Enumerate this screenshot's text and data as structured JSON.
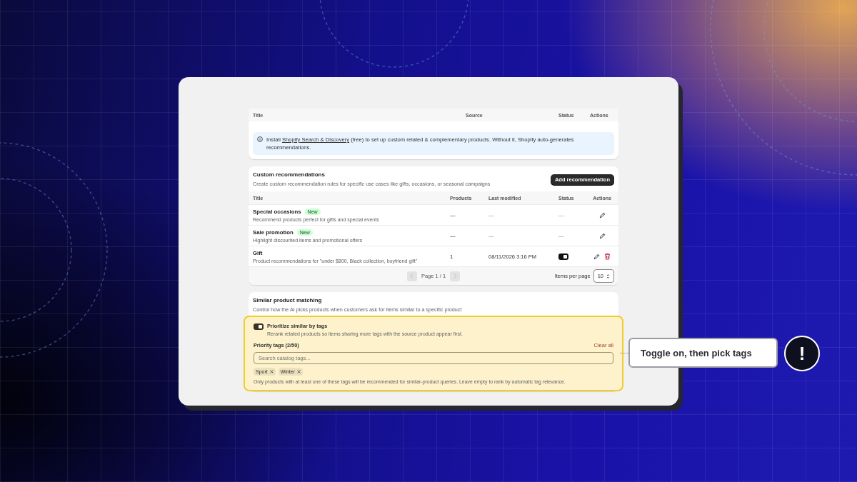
{
  "source_table": {
    "columns": [
      "Title",
      "Source",
      "Status",
      "Actions"
    ]
  },
  "info_banner": {
    "text_before": "Install ",
    "link": "Shopify Search & Discovery",
    "text_after": " (free) to set up custom related & complementary products. Without it, Shopify auto-generates recommendations."
  },
  "custom_recommendations": {
    "title": "Custom recommendations",
    "description": "Create custom recommendation rules for specific use cases like gifts, occasions, or seasonal campaigns",
    "add_button": "Add recommendation",
    "columns": [
      "Title",
      "Products",
      "Last modified",
      "Status",
      "Actions"
    ],
    "rows": [
      {
        "title": "Special occasions",
        "badge": "New",
        "description": "Recommend products perfect for gifts and special events",
        "products": "—",
        "last_modified": "—",
        "kind": "text",
        "status": "—",
        "deletable": false
      },
      {
        "title": "Sale promotion",
        "badge": "New",
        "description": "Highlight discounted items and promotional offers",
        "products": "—",
        "last_modified": "—",
        "kind": "text",
        "status": "—",
        "deletable": false
      },
      {
        "title": "Gift",
        "description": "Product recommendations for \"under $800, Black collection, boyfriend gift\"",
        "products": "1",
        "last_modified": "08/11/2026 3:16 PM",
        "kind": "toggle",
        "on": true,
        "deletable": true
      }
    ],
    "pagination": {
      "page": "Page 1 / 1",
      "prev_disabled": true,
      "next_disabled": true,
      "items_per_page_label": "Items per page",
      "items_per_page": "10"
    }
  },
  "similar_matching": {
    "title": "Similar product matching",
    "description": "Control how the AI picks products when customers ask for items similar to a specific product",
    "option": {
      "title": "Prioritize similar by tags",
      "description": "Rerank related products so items sharing more tags with the source product appear first.",
      "on": true,
      "highlighted": true
    },
    "priority_tags_label": "Priority tags (2/50)",
    "clear_all": "Clear all",
    "search": {
      "placeholder": "Search catalog tags..."
    },
    "tags": [
      "Sport",
      "Winter"
    ],
    "hint": "Only products with at least one of these tags will be recommended for similar-product queries. Leave empty to rank by automatic tag relevance."
  },
  "callout": {
    "text": "Toggle on, then pick tags",
    "badge": "!"
  }
}
